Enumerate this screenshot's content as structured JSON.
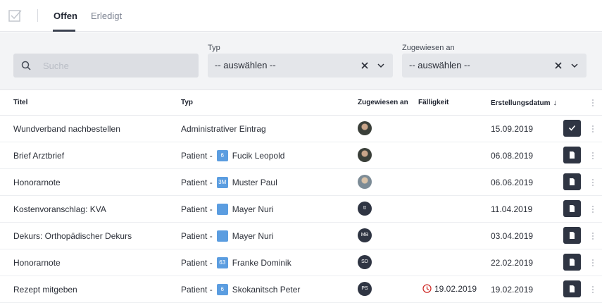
{
  "header": {
    "tabs": [
      {
        "label": "Offen",
        "active": true
      },
      {
        "label": "Erledigt",
        "active": false
      }
    ]
  },
  "filters": {
    "search_placeholder": "Suche",
    "type_label": "Typ",
    "type_value": "-- auswählen --",
    "assignee_label": "Zugewiesen an",
    "assignee_value": "-- auswählen --"
  },
  "table": {
    "columns": {
      "title": "Titel",
      "type": "Typ",
      "assignee": "Zugewiesen an",
      "due": "Fälligkeit",
      "created": "Erstellungsdatum"
    },
    "rows": [
      {
        "title": "Wundverband nachbestellen",
        "type_prefix": "Administrativer Eintrag",
        "badge": "",
        "patient": "",
        "avatar": "",
        "due": "",
        "created": "15.09.2019",
        "action": "check"
      },
      {
        "title": "Brief Arztbrief",
        "type_prefix": "Patient -",
        "badge": "6",
        "patient": "Fucik Leopold",
        "avatar": "",
        "due": "",
        "created": "06.08.2019",
        "action": "doc"
      },
      {
        "title": "Honorarnote",
        "type_prefix": "Patient -",
        "badge": "3M",
        "patient": "Muster Paul",
        "avatar": "",
        "due": "",
        "created": "06.06.2019",
        "action": "doc"
      },
      {
        "title": "Kostenvoranschlag: KVA",
        "type_prefix": "Patient -",
        "badge": "",
        "patient": "Mayer Nuri",
        "avatar": "tt",
        "due": "",
        "created": "11.04.2019",
        "action": "doc"
      },
      {
        "title": "Dekurs: Orthopädischer Dekurs",
        "type_prefix": "Patient -",
        "badge": "",
        "patient": "Mayer Nuri",
        "avatar": "MB",
        "due": "",
        "created": "03.04.2019",
        "action": "doc"
      },
      {
        "title": "Honorarnote",
        "type_prefix": "Patient -",
        "badge": "63",
        "patient": "Franke Dominik",
        "avatar": "SD",
        "due": "",
        "created": "22.02.2019",
        "action": "doc"
      },
      {
        "title": "Rezept mitgeben",
        "type_prefix": "Patient -",
        "badge": "6",
        "patient": "Skokanitsch Peter",
        "avatar": "PS",
        "due": "19.02.2019",
        "created": "19.02.2019",
        "action": "doc"
      }
    ]
  },
  "colors": {
    "accent_dark": "#2f3543",
    "patient_badge": "#5b9de0",
    "overdue": "#d0312d"
  }
}
